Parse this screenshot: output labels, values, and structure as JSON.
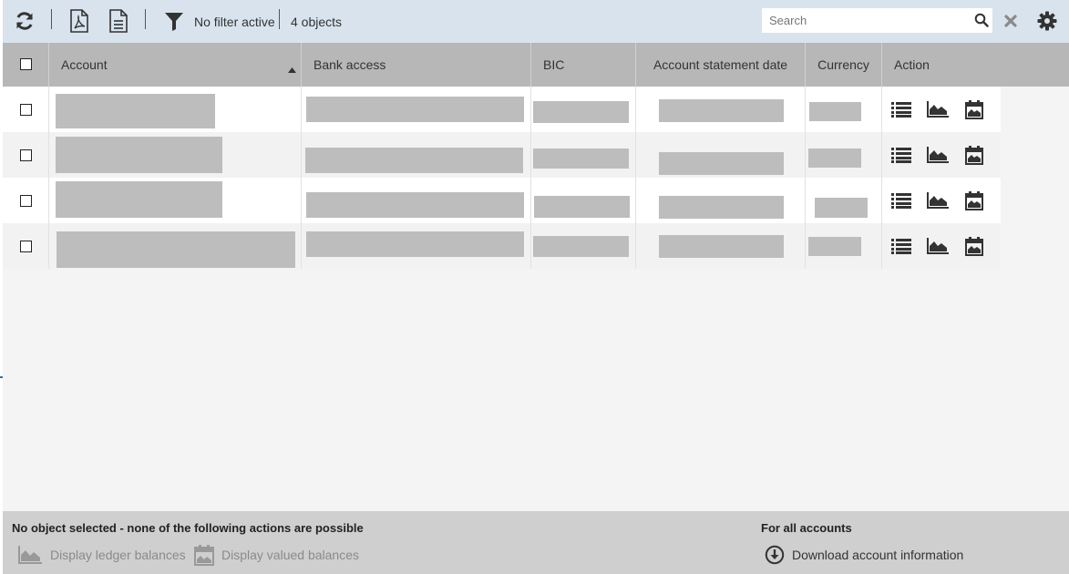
{
  "toolbar": {
    "filter_status": "No filter active",
    "object_count": "4 objects",
    "search_placeholder": "Search"
  },
  "table": {
    "columns": [
      "Account",
      "Bank access",
      "BIC",
      "Account statement date",
      "Currency",
      "Action"
    ],
    "sorted_column": "Account",
    "sort_direction": "ascending",
    "rows": [
      {
        "redacted": true
      },
      {
        "redacted": true
      },
      {
        "redacted": true
      },
      {
        "redacted": true
      }
    ]
  },
  "footer": {
    "selection_message": "No object selected - none of the following actions are possible",
    "selection_actions": [
      {
        "label": "Display ledger balances",
        "icon": "area-chart-icon",
        "enabled": false
      },
      {
        "label": "Display valued balances",
        "icon": "calendar-icon",
        "enabled": false
      }
    ],
    "all_accounts_title": "For all accounts",
    "all_accounts_action": {
      "label": "Download account information",
      "icon": "download-circle-icon"
    }
  },
  "colors": {
    "toolbar_bg": "#d8e3ee",
    "header_bg": "#b7b7b7",
    "footer_bg": "#cfcfcf",
    "redaction": "#bdbdbd"
  }
}
